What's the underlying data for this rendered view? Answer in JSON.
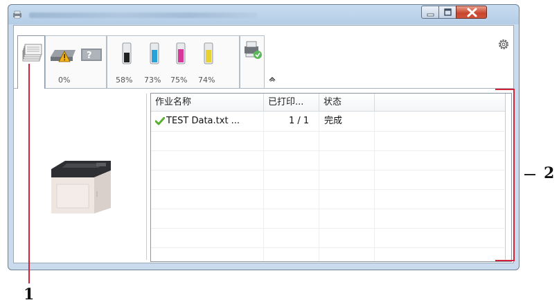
{
  "window": {
    "title_blurred": true
  },
  "toolbar": {
    "tabs": [
      {
        "name": "job-list",
        "active": true
      },
      {
        "name": "warning-status",
        "percent": "0%"
      },
      {
        "name": "toner-black",
        "percent": "58%",
        "color": "#222222"
      },
      {
        "name": "toner-cyan",
        "percent": "73%",
        "color": "#2aa0d8"
      },
      {
        "name": "toner-magenta",
        "percent": "75%",
        "color": "#d8379a"
      },
      {
        "name": "toner-yellow",
        "percent": "74%",
        "color": "#e6d233"
      },
      {
        "name": "device-ok"
      }
    ]
  },
  "table": {
    "columns": [
      "作业名称",
      "已打印...",
      "状态"
    ],
    "rows": [
      {
        "name": "TEST Data.txt ...",
        "printed": "1 / 1",
        "status": "完成"
      }
    ]
  },
  "callouts": {
    "one": "1",
    "two": "2"
  },
  "colors": {
    "callout": "#d1223a",
    "check": "#59b02f"
  }
}
